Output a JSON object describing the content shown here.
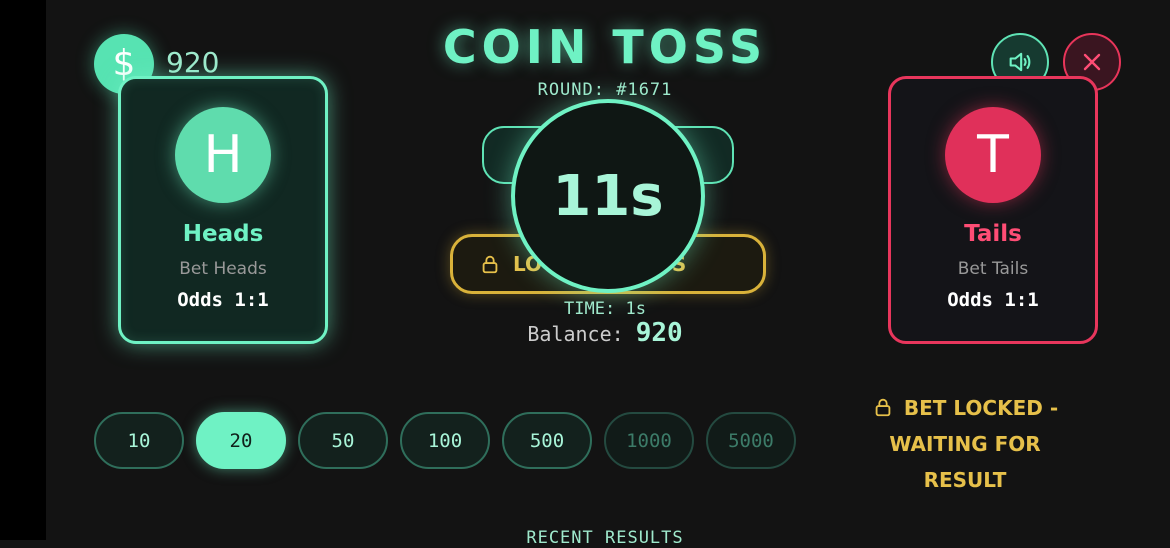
{
  "header": {
    "title": "COIN TOSS",
    "round": "ROUND: #1671",
    "balance": "920",
    "currency_icon": "dollar-icon",
    "sound_icon": "speaker-icon",
    "close_icon": "close-icon"
  },
  "heads": {
    "letter": "H",
    "name": "Heads",
    "bet_label": "Bet Heads",
    "odds": "Odds 1:1",
    "color": "#6ff2c4"
  },
  "tails": {
    "letter": "T",
    "name": "Tails",
    "bet_label": "Bet Tails",
    "odds": "Odds 1:1",
    "color": "#e8365c"
  },
  "center": {
    "timer": "11s",
    "lock_banner": "LOCKED HEADS",
    "time_line": "TIME: 1s",
    "balance_label": "Balance:",
    "balance_value": "920"
  },
  "chips": [
    {
      "label": "10",
      "state": "normal"
    },
    {
      "label": "20",
      "state": "selected"
    },
    {
      "label": "50",
      "state": "normal"
    },
    {
      "label": "100",
      "state": "normal"
    },
    {
      "label": "500",
      "state": "normal"
    },
    {
      "label": "1000",
      "state": "disabled"
    },
    {
      "label": "5000",
      "state": "disabled"
    }
  ],
  "status": {
    "line1": "BET LOCKED -",
    "line2": "WAITING FOR",
    "line3": "RESULT"
  },
  "recent_results_label": "RECENT RESULTS",
  "colors": {
    "accent": "#6ff2c4",
    "danger": "#e8365c",
    "warning": "#e6c04a",
    "background": "#131313"
  }
}
